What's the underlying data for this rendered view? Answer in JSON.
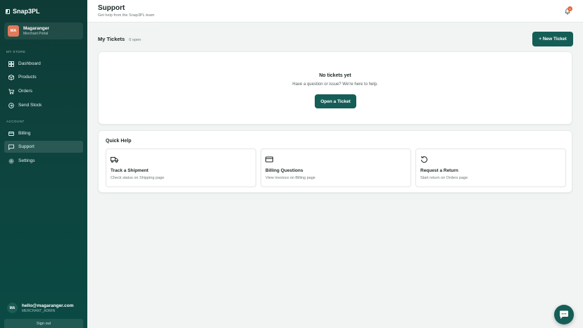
{
  "brand": {
    "name": "Snap3PL"
  },
  "account": {
    "initials": "MA",
    "name": "Magaranger",
    "subtitle": "Merchant Portal"
  },
  "sidebar": {
    "store_label": "MY STORE",
    "store_items": [
      {
        "label": "Dashboard",
        "icon": "grid-icon"
      },
      {
        "label": "Products",
        "icon": "box-icon"
      },
      {
        "label": "Orders",
        "icon": "cart-icon"
      },
      {
        "label": "Send Stock",
        "icon": "send-icon"
      }
    ],
    "account_label": "ACCOUNT",
    "account_items": [
      {
        "label": "Billing",
        "icon": "card-icon"
      },
      {
        "label": "Support",
        "icon": "chat-icon",
        "active": true
      },
      {
        "label": "Settings",
        "icon": "gear-icon"
      }
    ]
  },
  "user": {
    "initials": "MA",
    "email": "hello@magaranger.com",
    "role": "MERCHANT_ADMIN",
    "signout_label": "Sign out"
  },
  "header": {
    "title": "Support",
    "subtitle": "Get help from the Snap3PL team",
    "notification_count": "0"
  },
  "tickets": {
    "title": "My Tickets",
    "open_count": "0 open",
    "new_button": "+ New Ticket",
    "empty_title": "No tickets yet",
    "empty_subtitle": "Have a question or issue? We're here to help.",
    "open_button": "Open a Ticket"
  },
  "quick_help": {
    "title": "Quick Help",
    "items": [
      {
        "label": "Track a Shipment",
        "description": "Check status on Shipping page",
        "icon": "truck-icon"
      },
      {
        "label": "Billing Questions",
        "description": "View invoices on Billing page",
        "icon": "credit-card-icon"
      },
      {
        "label": "Request a Return",
        "description": "Start return on Orders page",
        "icon": "return-icon"
      }
    ]
  },
  "colors": {
    "sidebar": "#0f3b36",
    "accent": "#155e57",
    "avatar": "#e07b5a"
  }
}
